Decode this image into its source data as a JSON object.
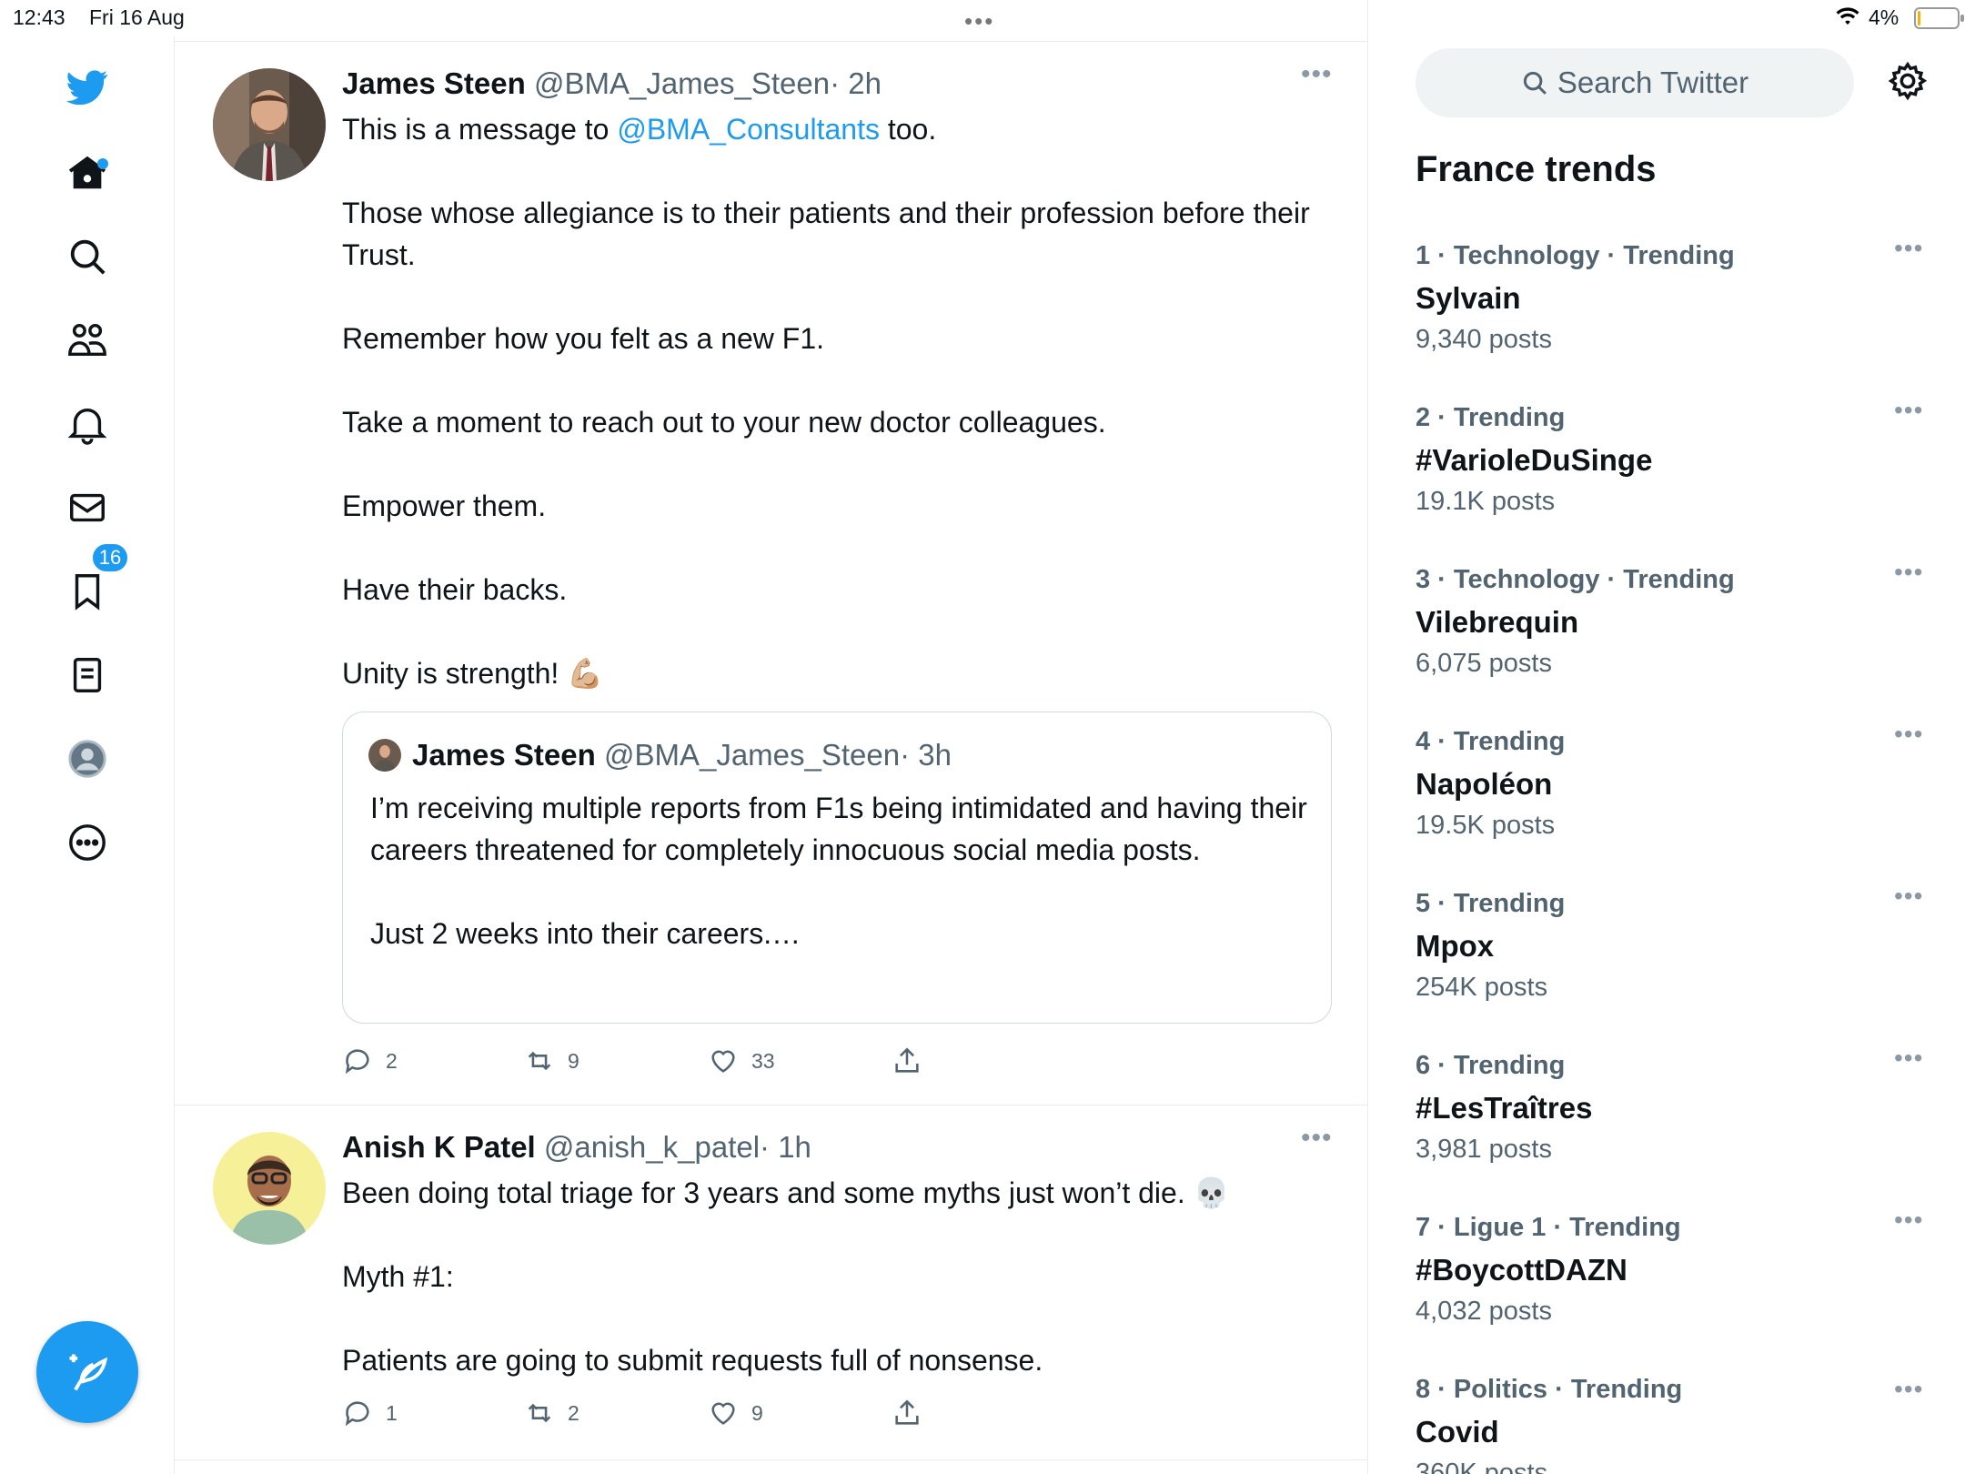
{
  "status_bar": {
    "time": "12:43",
    "date": "Fri 16 Aug",
    "battery": "4%"
  },
  "compose_label": "Compose",
  "notifications_badge": "16",
  "tweets": [
    {
      "name": "James Steen",
      "handle": "@BMA_James_Steen",
      "time": "· 2h",
      "text_prefix": "This is a message to ",
      "mention": "@BMA_Consultants",
      "text_suffix": " too.",
      "paragraphs": [
        "Those whose allegiance is to their patients and their profession before their Trust.",
        "Remember how you felt as a new F1.",
        "Take a moment to reach out to your new doctor colleagues.",
        "Empower them.",
        "Have their backs.",
        "Unity is strength! 💪🏼"
      ],
      "quote": {
        "name": "James Steen",
        "handle": "@BMA_James_Steen",
        "time": "· 3h",
        "paragraphs": [
          "I’m receiving multiple reports from F1s being intimidated and having their careers threatened for completely innocuous social media posts.",
          "Just 2 weeks into their careers.…"
        ]
      },
      "replies": "2",
      "retweets": "9",
      "likes": "33"
    },
    {
      "name": "Anish K Patel",
      "handle": "@anish_k_patel",
      "time": "· 1h",
      "paragraphs": [
        "Been doing total triage for 3 years and some myths just won’t die.  💀",
        "Myth #1:",
        "Patients are going to submit requests full of nonsense."
      ],
      "replies": "1",
      "retweets": "2",
      "likes": "9"
    }
  ],
  "sidebar": {
    "search_placeholder": "Search Twitter",
    "trends_title": "France trends",
    "trends": [
      {
        "meta": "1 · Technology · Trending",
        "name": "Sylvain",
        "count": "9,340 posts"
      },
      {
        "meta": "2 · Trending",
        "name": "#VarioleDuSinge",
        "count": "19.1K posts"
      },
      {
        "meta": "3 · Technology · Trending",
        "name": "Vilebrequin",
        "count": "6,075 posts"
      },
      {
        "meta": "4 · Trending",
        "name": "Napoléon",
        "count": "19.5K posts"
      },
      {
        "meta": "5 · Trending",
        "name": "Mpox",
        "count": "254K posts"
      },
      {
        "meta": "6 · Trending",
        "name": "#LesTraîtres",
        "count": "3,981 posts"
      },
      {
        "meta": "7 · Ligue 1 · Trending",
        "name": "#BoycottDAZN",
        "count": "4,032 posts"
      },
      {
        "meta": "8 · Politics · Trending",
        "name": "Covid",
        "count": "360K posts"
      }
    ]
  },
  "colors": {
    "accent": "#1d9bf0",
    "text": "#0f1419",
    "secondary": "#536471",
    "border": "#e6ecf0"
  }
}
